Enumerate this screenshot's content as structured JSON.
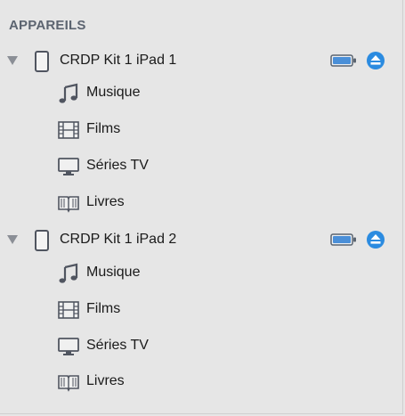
{
  "sidebar": {
    "section_title": "APPAREILS",
    "devices": [
      {
        "name": "CRDP Kit 1 iPad 1",
        "items": [
          {
            "label": "Musique",
            "icon": "music-note-icon"
          },
          {
            "label": "Films",
            "icon": "film-icon"
          },
          {
            "label": "Séries TV",
            "icon": "tv-icon"
          },
          {
            "label": "Livres",
            "icon": "book-icon"
          }
        ]
      },
      {
        "name": "CRDP Kit 1 iPad 2",
        "items": [
          {
            "label": "Musique",
            "icon": "music-note-icon"
          },
          {
            "label": "Films",
            "icon": "film-icon"
          },
          {
            "label": "Séries TV",
            "icon": "tv-icon"
          },
          {
            "label": "Livres",
            "icon": "book-icon"
          }
        ]
      }
    ]
  },
  "colors": {
    "background": "#e6e6e6",
    "accent_blue": "#2b8be0",
    "icon_gray": "#505560",
    "header_gray": "#5c6470"
  }
}
